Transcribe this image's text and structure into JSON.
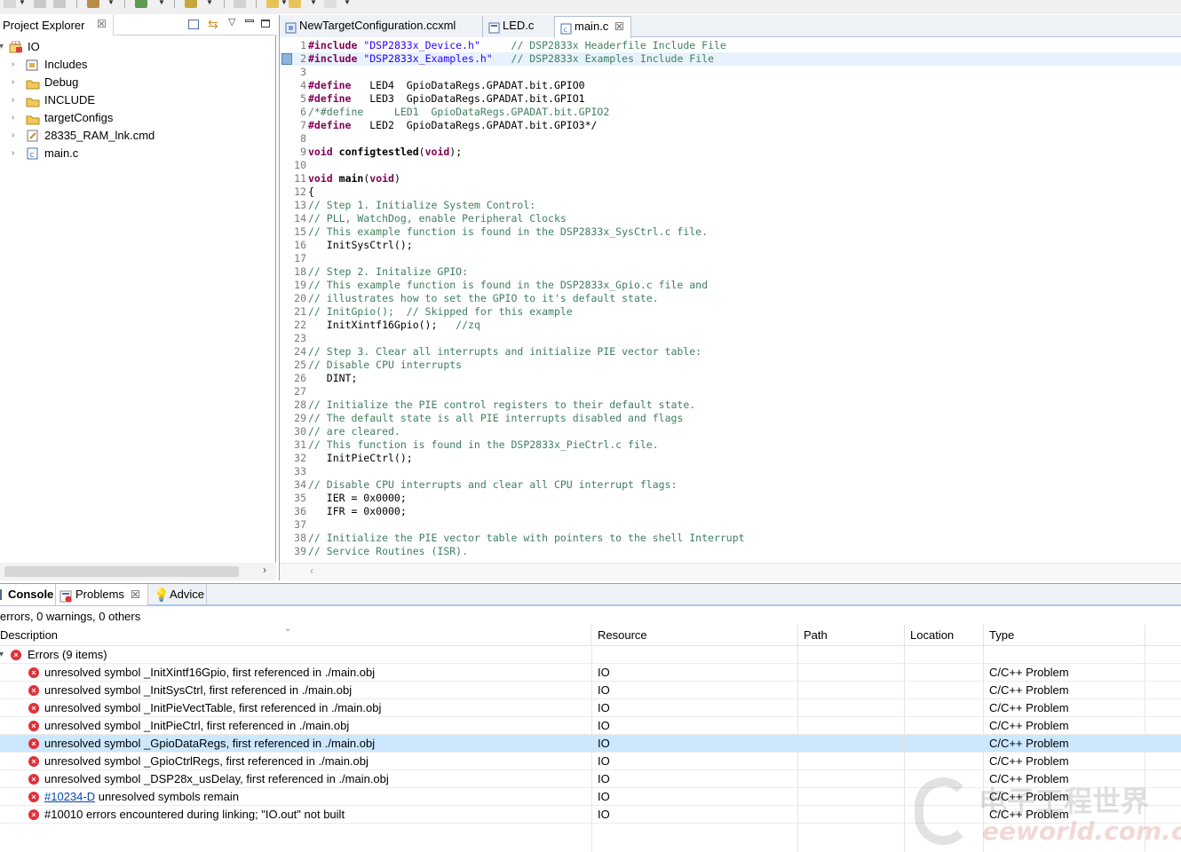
{
  "explorer": {
    "title": "Project Explorer",
    "root": "IO",
    "items": [
      {
        "label": "Includes",
        "icon": "includes-icon"
      },
      {
        "label": "Debug",
        "icon": "folder-icon"
      },
      {
        "label": "INCLUDE",
        "icon": "folder-icon"
      },
      {
        "label": "targetConfigs",
        "icon": "folder-icon"
      },
      {
        "label": "28335_RAM_lnk.cmd",
        "icon": "cmd-file-icon"
      },
      {
        "label": "main.c",
        "icon": "c-file-icon"
      }
    ]
  },
  "editor": {
    "tabs": [
      {
        "label": "NewTargetConfiguration.ccxml",
        "active": false
      },
      {
        "label": "LED.c",
        "active": false
      },
      {
        "label": "main.c",
        "active": true
      }
    ],
    "lines": [
      {
        "n": "1",
        "t": "#include \"DSP2833x_Device.h\"     // DSP2833x Headerfile Include File"
      },
      {
        "n": "2",
        "t": "#include \"DSP2833x_Examples.h\"   // DSP2833x Examples Include File"
      },
      {
        "n": "3",
        "t": ""
      },
      {
        "n": "4",
        "t": "#define   LED4  GpioDataRegs.GPADAT.bit.GPIO0"
      },
      {
        "n": "5",
        "t": "#define   LED3  GpioDataRegs.GPADAT.bit.GPIO1"
      },
      {
        "n": "6",
        "t": "/*#define     LED1  GpioDataRegs.GPADAT.bit.GPIO2"
      },
      {
        "n": "7",
        "t": "#define   LED2  GpioDataRegs.GPADAT.bit.GPIO3*/"
      },
      {
        "n": "8",
        "t": ""
      },
      {
        "n": "9",
        "t": "void configtestled(void);"
      },
      {
        "n": "10",
        "t": ""
      },
      {
        "n": "11",
        "t": "void main(void)"
      },
      {
        "n": "12",
        "t": "{"
      },
      {
        "n": "13",
        "t": "// Step 1. Initialize System Control:"
      },
      {
        "n": "14",
        "t": "// PLL, WatchDog, enable Peripheral Clocks"
      },
      {
        "n": "15",
        "t": "// This example function is found in the DSP2833x_SysCtrl.c file."
      },
      {
        "n": "16",
        "t": "   InitSysCtrl();"
      },
      {
        "n": "17",
        "t": ""
      },
      {
        "n": "18",
        "t": "// Step 2. Initalize GPIO:"
      },
      {
        "n": "19",
        "t": "// This example function is found in the DSP2833x_Gpio.c file and"
      },
      {
        "n": "20",
        "t": "// illustrates how to set the GPIO to it's default state."
      },
      {
        "n": "21",
        "t": "// InitGpio();  // Skipped for this example"
      },
      {
        "n": "22",
        "t": "   InitXintf16Gpio();   //zq"
      },
      {
        "n": "23",
        "t": ""
      },
      {
        "n": "24",
        "t": "// Step 3. Clear all interrupts and initialize PIE vector table:"
      },
      {
        "n": "25",
        "t": "// Disable CPU interrupts"
      },
      {
        "n": "26",
        "t": "   DINT;"
      },
      {
        "n": "27",
        "t": ""
      },
      {
        "n": "28",
        "t": "// Initialize the PIE control registers to their default state."
      },
      {
        "n": "29",
        "t": "// The default state is all PIE interrupts disabled and flags"
      },
      {
        "n": "30",
        "t": "// are cleared."
      },
      {
        "n": "31",
        "t": "// This function is found in the DSP2833x_PieCtrl.c file."
      },
      {
        "n": "32",
        "t": "   InitPieCtrl();"
      },
      {
        "n": "33",
        "t": ""
      },
      {
        "n": "34",
        "t": "// Disable CPU interrupts and clear all CPU interrupt flags:"
      },
      {
        "n": "35",
        "t": "   IER = 0x0000;"
      },
      {
        "n": "36",
        "t": "   IFR = 0x0000;"
      },
      {
        "n": "37",
        "t": ""
      },
      {
        "n": "38",
        "t": "// Initialize the PIE vector table with pointers to the shell Interrupt"
      },
      {
        "n": "39",
        "t": "// Service Routines (ISR)."
      }
    ]
  },
  "bottom": {
    "tabs": [
      {
        "label": "Console",
        "icon": "console-icon"
      },
      {
        "label": "Problems",
        "icon": "problems-icon"
      },
      {
        "label": "Advice",
        "icon": "lightbulb-icon"
      }
    ],
    "summary": "errors, 0 warnings, 0 others",
    "columns": [
      "Description",
      "Resource",
      "Path",
      "Location",
      "Type"
    ],
    "group_label": "Errors (9 items)",
    "rows": [
      {
        "link": "",
        "desc": "unresolved symbol _InitXintf16Gpio, first referenced in ./main.obj",
        "resource": "IO",
        "path": "",
        "location": "",
        "type": "C/C++ Problem"
      },
      {
        "link": "",
        "desc": "unresolved symbol _InitSysCtrl, first referenced in ./main.obj",
        "resource": "IO",
        "path": "",
        "location": "",
        "type": "C/C++ Problem"
      },
      {
        "link": "",
        "desc": "unresolved symbol _InitPieVectTable, first referenced in ./main.obj",
        "resource": "IO",
        "path": "",
        "location": "",
        "type": "C/C++ Problem"
      },
      {
        "link": "",
        "desc": "unresolved symbol _InitPieCtrl, first referenced in ./main.obj",
        "resource": "IO",
        "path": "",
        "location": "",
        "type": "C/C++ Problem"
      },
      {
        "link": "",
        "desc": "unresolved symbol _GpioDataRegs, first referenced in ./main.obj",
        "resource": "IO",
        "path": "",
        "location": "",
        "type": "C/C++ Problem"
      },
      {
        "link": "",
        "desc": "unresolved symbol _GpioCtrlRegs, first referenced in ./main.obj",
        "resource": "IO",
        "path": "",
        "location": "",
        "type": "C/C++ Problem"
      },
      {
        "link": "",
        "desc": "unresolved symbol _DSP28x_usDelay, first referenced in ./main.obj",
        "resource": "IO",
        "path": "",
        "location": "",
        "type": "C/C++ Problem"
      },
      {
        "link": "#10234-D",
        "desc": "unresolved symbols remain",
        "resource": "IO",
        "path": "",
        "location": "",
        "type": "C/C++ Problem"
      },
      {
        "link": "",
        "desc": "#10010 errors encountered during linking; \"IO.out\" not built",
        "resource": "IO",
        "path": "",
        "location": "",
        "type": "C/C++ Problem"
      }
    ],
    "selected_row": 4
  },
  "watermark": {
    "cn": "电子工程世界",
    "en": "eeworld.com.cn"
  },
  "colors": {
    "error": "#e0313a",
    "selection": "#cce8ff",
    "keyword": "#7f0055",
    "string": "#2a00ff",
    "comment": "#3f7f5f"
  }
}
